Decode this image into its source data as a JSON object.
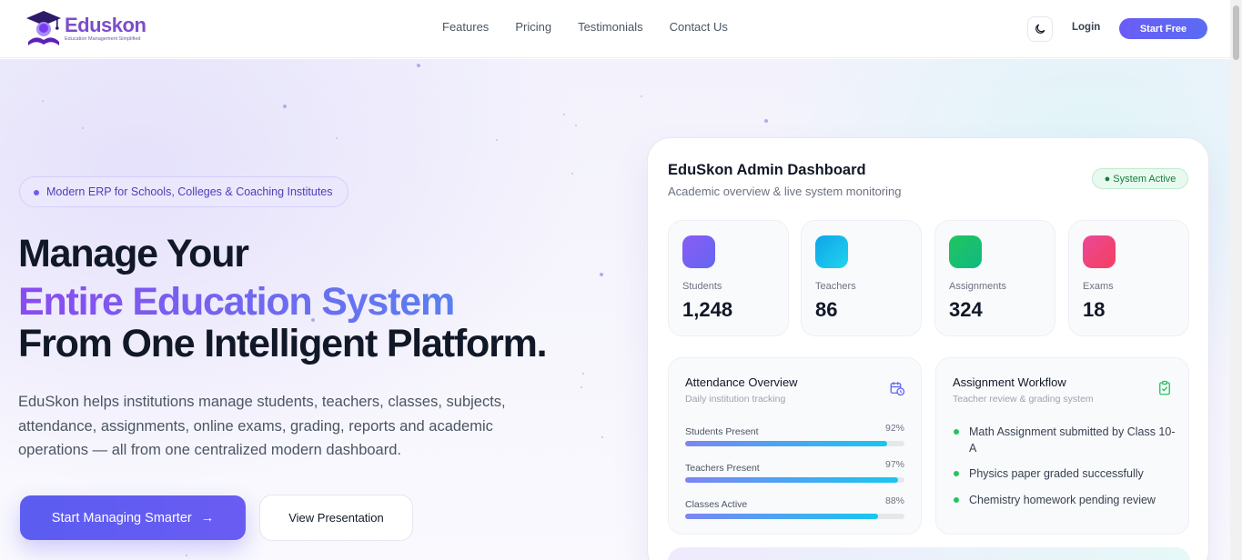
{
  "nav": {
    "logo_name": "Eduskon",
    "logo_tagline": "Education Management Simplified",
    "links": [
      "Features",
      "Pricing",
      "Testimonials",
      "Contact Us"
    ],
    "login": "Login",
    "start_free": "Start Free"
  },
  "hero": {
    "badge": "Modern ERP for Schools, Colleges & Coaching Institutes",
    "title_line1": "Manage Your",
    "title_line2": "Entire Education System",
    "title_line3": "From One Intelligent Platform.",
    "description": "EduSkon helps institutions manage students, teachers, classes, subjects, attendance, assignments, online exams, grading, reports and academic operations — all from one centralized modern dashboard.",
    "cta_primary": "Start Managing Smarter",
    "cta_primary_arrow": "→",
    "cta_secondary": "View Presentation"
  },
  "dashboard": {
    "title": "EduSkon Admin Dashboard",
    "subtitle": "Academic overview & live system monitoring",
    "status": "● System Active",
    "stats": [
      {
        "label": "Students",
        "value": "1,248",
        "color": "#8b5cf6"
      },
      {
        "label": "Teachers",
        "value": "86",
        "color": "#0ea5e9"
      },
      {
        "label": "Assignments",
        "value": "324",
        "color": "#22c55e"
      },
      {
        "label": "Exams",
        "value": "18",
        "color": "#ec4899"
      }
    ],
    "attendance": {
      "title": "Attendance Overview",
      "subtitle": "Daily institution tracking",
      "icon": "calendar-clock-icon",
      "rows": [
        {
          "label": "Students Present",
          "pct": "92%",
          "value": 92
        },
        {
          "label": "Teachers Present",
          "pct": "97%",
          "value": 97
        },
        {
          "label": "Classes Active",
          "pct": "88%",
          "value": 88
        }
      ]
    },
    "workflow": {
      "title": "Assignment Workflow",
      "subtitle": "Teacher review & grading system",
      "icon": "clipboard-check-icon",
      "items": [
        "Math Assignment submitted by Class 10-A",
        "Physics paper graded successfully",
        "Chemistry homework pending review"
      ]
    }
  },
  "colors": {
    "accent": "#6b5cf6",
    "success": "#22c55e",
    "text": "#111827"
  }
}
